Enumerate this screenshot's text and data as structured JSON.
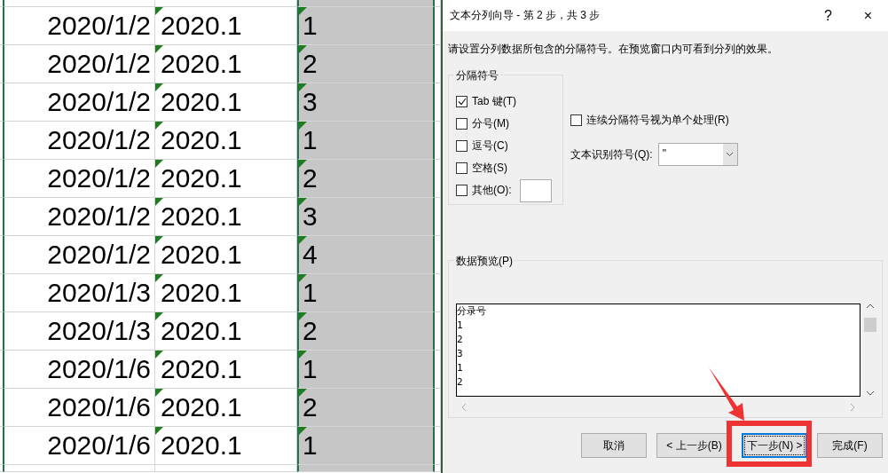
{
  "sheet": {
    "rows": [
      {
        "date": "2020/1/2",
        "period": "2020.1",
        "entry": "1"
      },
      {
        "date": "2020/1/2",
        "period": "2020.1",
        "entry": "2"
      },
      {
        "date": "2020/1/2",
        "period": "2020.1",
        "entry": "3"
      },
      {
        "date": "2020/1/2",
        "period": "2020.1",
        "entry": "1"
      },
      {
        "date": "2020/1/2",
        "period": "2020.1",
        "entry": "2"
      },
      {
        "date": "2020/1/2",
        "period": "2020.1",
        "entry": "3"
      },
      {
        "date": "2020/1/2",
        "period": "2020.1",
        "entry": "4"
      },
      {
        "date": "2020/1/3",
        "period": "2020.1",
        "entry": "1"
      },
      {
        "date": "2020/1/3",
        "period": "2020.1",
        "entry": "2"
      },
      {
        "date": "2020/1/6",
        "period": "2020.1",
        "entry": "1"
      },
      {
        "date": "2020/1/6",
        "period": "2020.1",
        "entry": "2"
      },
      {
        "date": "2020/1/6",
        "period": "2020.1",
        "entry": "1"
      }
    ]
  },
  "dialog": {
    "title": "文本分列向导 - 第 2 步，共 3 步",
    "help": "?",
    "close": "×",
    "instruction": "请设置分列数据所包含的分隔符号。在预览窗口内可看到分列的效果。",
    "delimiters": {
      "legend": "分隔符号",
      "options": [
        {
          "label": "Tab 键(T)",
          "checked": true
        },
        {
          "label": "分号(M)",
          "checked": false
        },
        {
          "label": "逗号(C)",
          "checked": false
        },
        {
          "label": "空格(S)",
          "checked": false
        },
        {
          "label": "其他(O):",
          "checked": false
        }
      ]
    },
    "consecutive": {
      "label": "连续分隔符号视为单个处理(R)",
      "checked": false
    },
    "qualifier": {
      "label": "文本识别符号(Q):",
      "value": "\""
    },
    "preview": {
      "legend": "数据预览(P)",
      "lines": [
        "分录号",
        "1",
        "2",
        "3",
        "1",
        "2"
      ]
    },
    "buttons": [
      {
        "label": "取消",
        "focused": false
      },
      {
        "label": "< 上一步(B)",
        "focused": false
      },
      {
        "label": "下一步(N) >",
        "focused": true
      },
      {
        "label": "完成(F)",
        "focused": false
      }
    ]
  }
}
